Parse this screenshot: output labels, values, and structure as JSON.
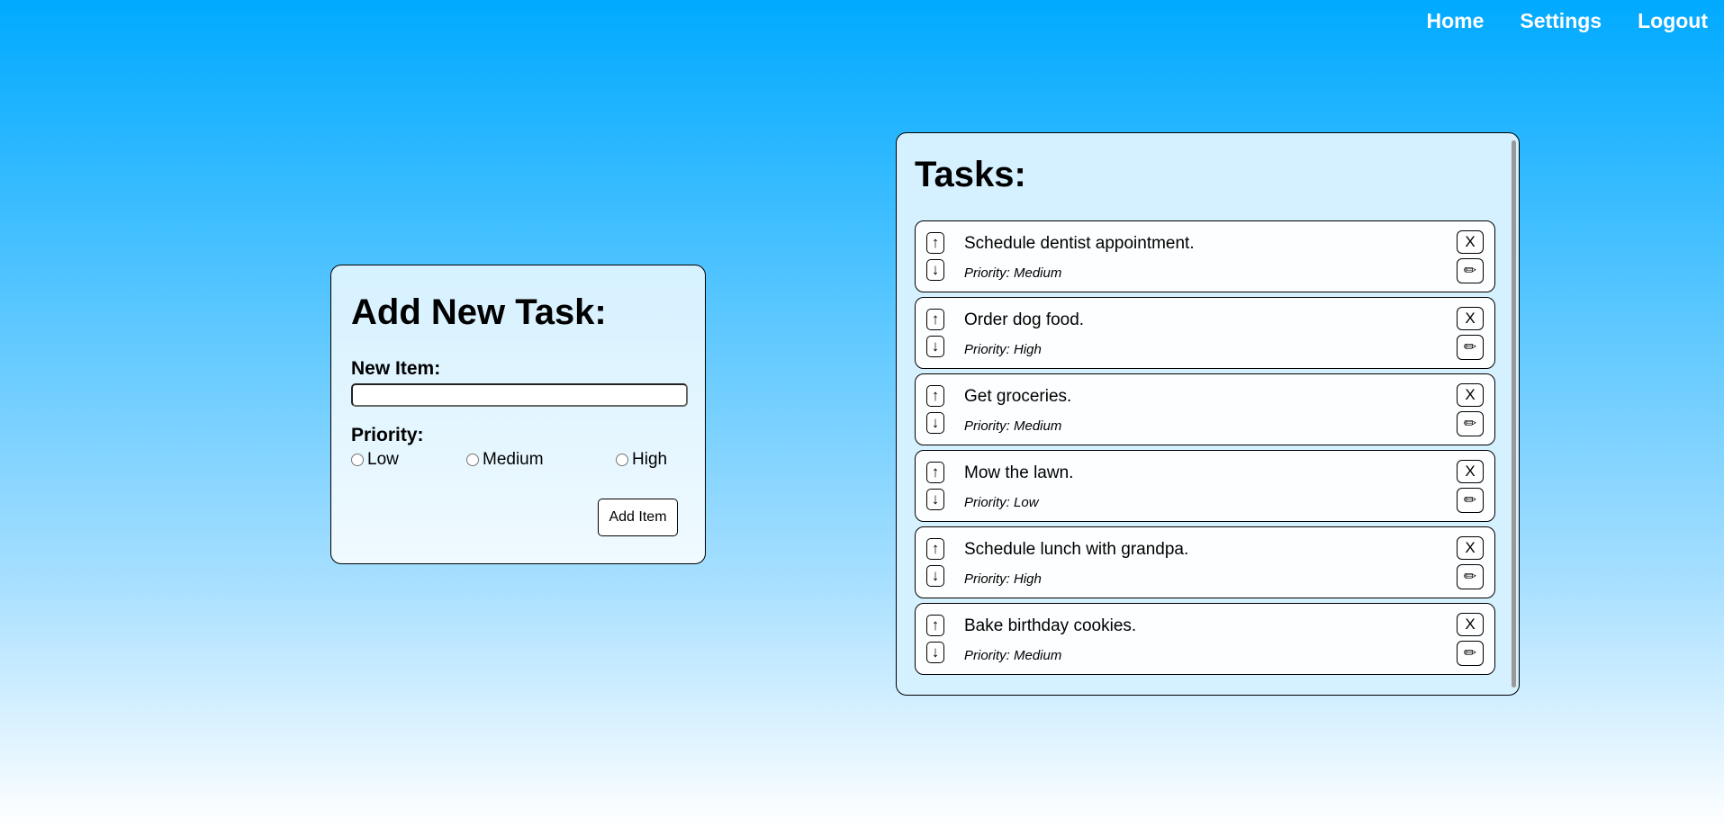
{
  "nav": {
    "items": [
      "Home",
      "Settings",
      "Logout"
    ]
  },
  "add_form": {
    "title": "Add New Task:",
    "new_item_label": "New Item:",
    "new_item_value": "",
    "priority_label": "Priority:",
    "priorities": [
      "Low",
      "Medium",
      "High"
    ],
    "add_button": "Add Item"
  },
  "tasks": {
    "title": "Tasks:",
    "up_symbol": "↑",
    "down_symbol": "↓",
    "delete_symbol": "X",
    "edit_symbol": "✏",
    "items": [
      {
        "name": "Schedule dentist appointment.",
        "priority": "Priority: Medium"
      },
      {
        "name": "Order dog food.",
        "priority": "Priority: High"
      },
      {
        "name": "Get groceries.",
        "priority": "Priority: Medium"
      },
      {
        "name": "Mow the lawn.",
        "priority": "Priority: Low"
      },
      {
        "name": "Schedule lunch with grandpa.",
        "priority": "Priority: High"
      },
      {
        "name": "Bake birthday cookies.",
        "priority": "Priority: Medium"
      }
    ]
  },
  "colors": {
    "background_top": "#00aaff",
    "background_bottom": "#ffffff",
    "card": "#d5f1ff"
  }
}
